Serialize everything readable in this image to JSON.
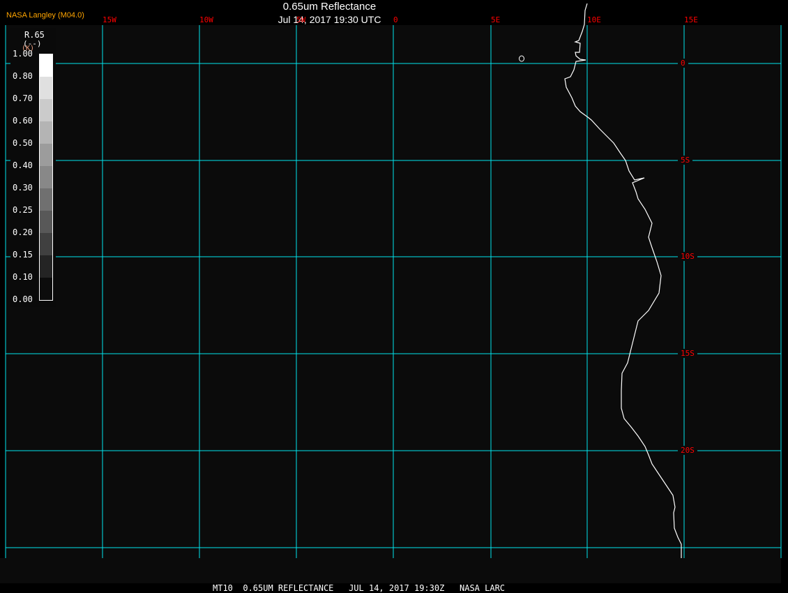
{
  "title": "0.65um Reflectance",
  "subtitle": "Jul 14, 2017 19:30 UTC",
  "credit": "NASA Langley (M04.0)",
  "footer": "MT10  0.65UM REFLECTANCE   JUL 14, 2017 19:30Z   NASA LARC",
  "grid_color": "#00e5ee",
  "label_color": "#ff0000",
  "coastline_color": "#ffffff",
  "longitude_labels": [
    "15W",
    "10W",
    "5W",
    "0",
    "5E",
    "10E",
    "15E"
  ],
  "latitude_labels": [
    "0",
    "5S",
    "10S",
    "15S",
    "20S"
  ],
  "legend": {
    "name": "R.65",
    "units": "(--)",
    "unit_k": "(K)",
    "ticks": [
      "1.00",
      "0.80",
      "0.70",
      "0.60",
      "0.50",
      "0.40",
      "0.30",
      "0.25",
      "0.20",
      "0.15",
      "0.10",
      "0.00"
    ],
    "colors": [
      "#ffffff",
      "#e0e0e0",
      "#cbcbcb",
      "#b4b4b4",
      "#9c9c9c",
      "#888888",
      "#707070",
      "#585858",
      "#404040",
      "#242424",
      "#0c0c0c"
    ]
  }
}
